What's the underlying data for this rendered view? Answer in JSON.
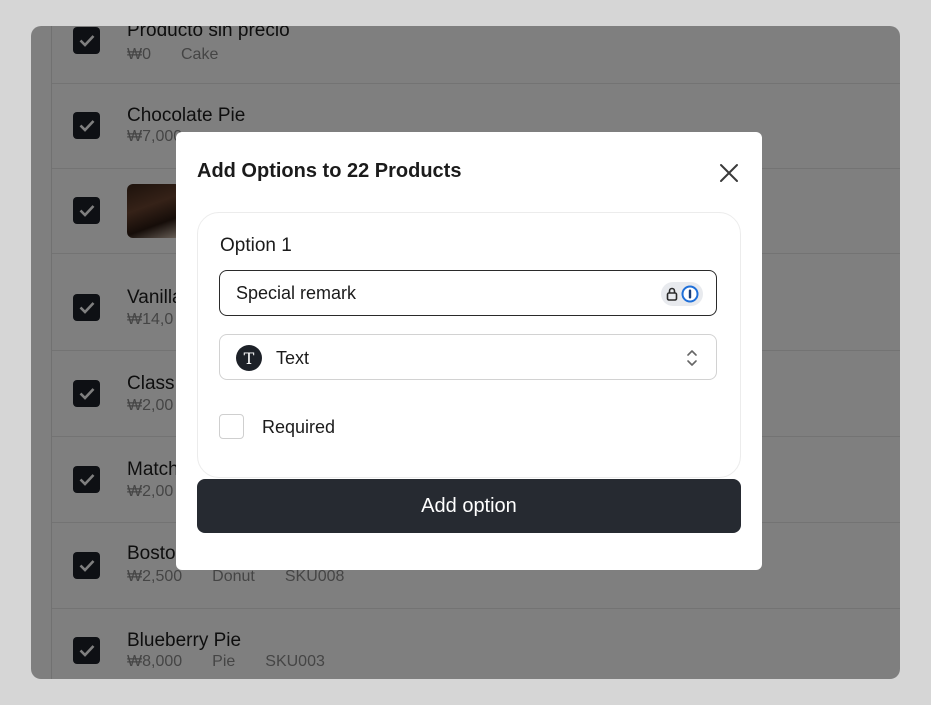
{
  "products": [
    {
      "name": "Producto sin precio",
      "price": "₩0",
      "category": "Cake",
      "sku": ""
    },
    {
      "name": "Chocolate Pie",
      "price": "₩7,000",
      "category": "",
      "sku": ""
    },
    {
      "name": "",
      "price": "",
      "category": "",
      "sku": "",
      "has_image": true
    },
    {
      "name": "Vanilla",
      "price": "₩14,0",
      "category": "",
      "sku": ""
    },
    {
      "name": "Class",
      "price": "₩2,00",
      "category": "",
      "sku": ""
    },
    {
      "name": "Match",
      "price": "₩2,00",
      "category": "",
      "sku": ""
    },
    {
      "name": "Bosto",
      "price": "₩2,500",
      "category": "Donut",
      "sku": "SKU008"
    },
    {
      "name": "Blueberry Pie",
      "price": "₩8,000",
      "category": "Pie",
      "sku": "SKU003"
    }
  ],
  "modal": {
    "title": "Add Options to 22 Products",
    "option_label": "Option 1",
    "option_name_value": "Special remark",
    "type_icon_letter": "T",
    "type_value": "Text",
    "required_label": "Required",
    "add_button_label": "Add option"
  },
  "colors": {
    "primary_dark": "#262a31",
    "backdrop": "rgba(0,0,0,0.5)"
  }
}
